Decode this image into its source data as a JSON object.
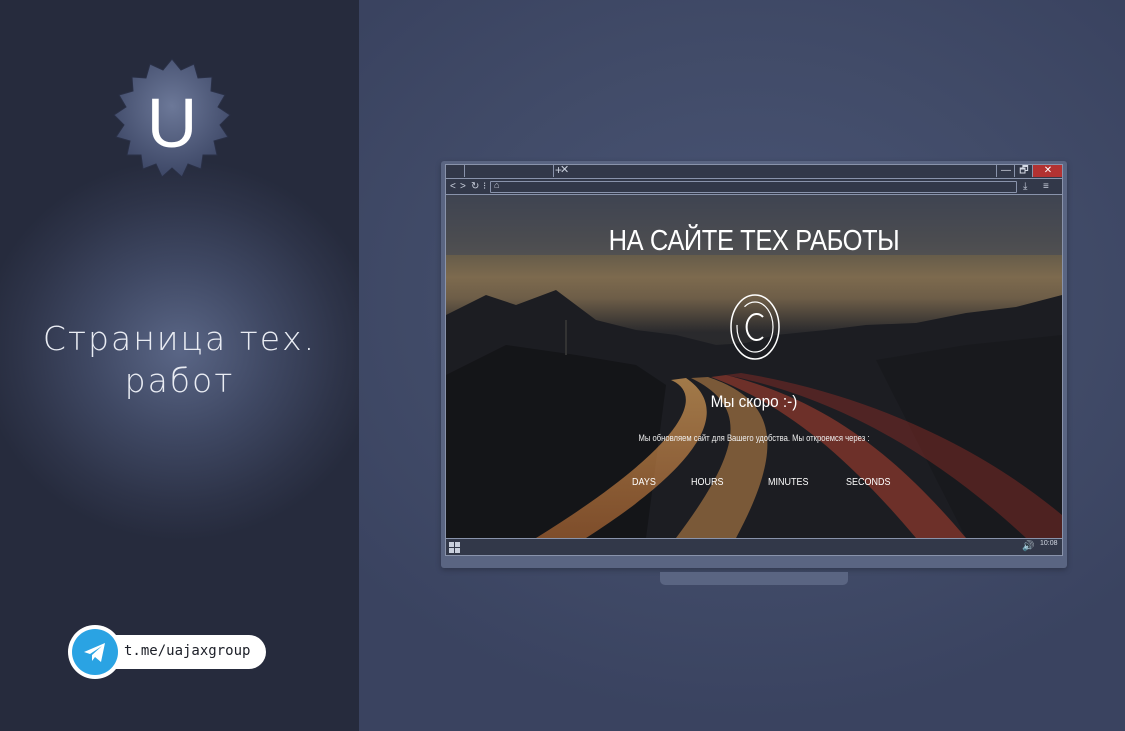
{
  "brand": {
    "logo_letter": "U"
  },
  "left": {
    "subtitle_line1": "Страница тех.",
    "subtitle_line2": "работ"
  },
  "telegram": {
    "link_text": "t.me/uajaxgroup"
  },
  "browser": {
    "window_controls": {
      "minimize": "—",
      "restore": "🗗",
      "close": "✕"
    },
    "tab_close": "✕",
    "new_tab": "+"
  },
  "site": {
    "title": "НА САЙТЕ ТЕХ РАБОТЫ",
    "heading": "Мы скоро :-)",
    "description": "Мы обновляем сайт для Вашего удобства. Мы откроемся через :",
    "countdown": {
      "days": "DAYS",
      "hours": "HOURS",
      "minutes": "MINUTES",
      "seconds": "SECONDS"
    }
  },
  "taskbar": {
    "clock": "10:08"
  },
  "colors": {
    "close": "#b23232",
    "telegram": "#2aa3e3",
    "panel": "#2e3449"
  }
}
